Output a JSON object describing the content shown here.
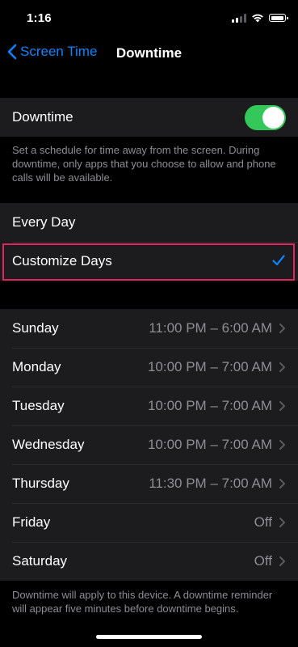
{
  "status": {
    "time": "1:16"
  },
  "nav": {
    "back_label": "Screen Time",
    "title": "Downtime"
  },
  "downtime": {
    "label": "Downtime",
    "enabled": true,
    "description": "Set a schedule for time away from the screen. During downtime, only apps that you choose to allow and phone calls will be available."
  },
  "schedule": {
    "options": [
      {
        "label": "Every Day",
        "selected": false
      },
      {
        "label": "Customize Days",
        "selected": true
      }
    ]
  },
  "days": [
    {
      "label": "Sunday",
      "value": "11:00 PM – 6:00 AM"
    },
    {
      "label": "Monday",
      "value": "10:00 PM – 7:00 AM"
    },
    {
      "label": "Tuesday",
      "value": "10:00 PM – 7:00 AM"
    },
    {
      "label": "Wednesday",
      "value": "10:00 PM – 7:00 AM"
    },
    {
      "label": "Thursday",
      "value": "11:30 PM – 7:00 AM"
    },
    {
      "label": "Friday",
      "value": "Off"
    },
    {
      "label": "Saturday",
      "value": "Off"
    }
  ],
  "footer_note": "Downtime will apply to this device. A downtime reminder will appear five minutes before downtime begins.",
  "colors": {
    "accent": "#0a84ff",
    "toggle_on": "#34c759",
    "highlight": "#e0245e"
  }
}
